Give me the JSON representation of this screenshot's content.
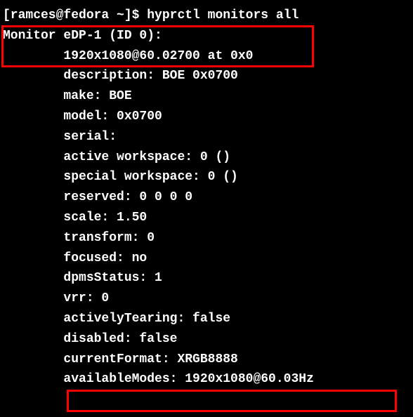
{
  "prompt": "[ramces@fedora ~]$ ",
  "command": "hyprctl monitors all",
  "output": {
    "monitor_header": "Monitor eDP-1 (ID 0):",
    "resolution": "        1920x1080@60.02700 at 0x0",
    "description": "        description: BOE 0x0700",
    "make": "        make: BOE",
    "model": "        model: 0x0700",
    "serial": "        serial:",
    "active_workspace": "        active workspace: 0 ()",
    "special_workspace": "        special workspace: 0 ()",
    "reserved": "        reserved: 0 0 0 0",
    "scale": "        scale: 1.50",
    "transform": "        transform: 0",
    "focused": "        focused: no",
    "dpms_status": "        dpmsStatus: 1",
    "vrr": "        vrr: 0",
    "actively_tearing": "        activelyTearing: false",
    "disabled": "        disabled: false",
    "current_format": "        currentFormat: XRGB8888",
    "available_modes": "        availableModes: 1920x1080@60.03Hz"
  }
}
